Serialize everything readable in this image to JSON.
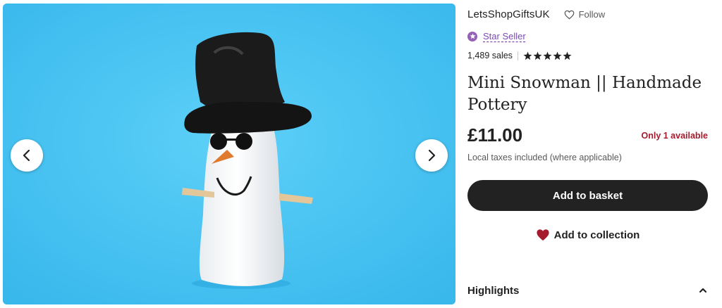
{
  "gallery": {
    "image_alt": "Mini snowman pottery figurine with black top hat and sunglasses on a blue background",
    "prev_icon": "chevron-left-icon",
    "next_icon": "chevron-right-icon",
    "background_color": "#4cc5f4"
  },
  "shop": {
    "name": "LetsShopGiftsUK",
    "follow_label": "Follow",
    "follow_icon": "heart-outline-icon",
    "badge_label": "Star Seller",
    "badge_icon": "star-seller-badge-icon",
    "sales": "1,489 sales",
    "rating_stars": 5
  },
  "listing": {
    "title": "Mini Snowman || Handmade Pottery",
    "price": "£11.00",
    "availability": "Only 1 available",
    "tax_note": "Local taxes included (where applicable)"
  },
  "actions": {
    "add_to_basket": "Add to basket",
    "add_to_collection": "Add to collection",
    "collection_icon": "heart-filled-icon"
  },
  "sections": {
    "highlights": "Highlights",
    "highlights_icon": "chevron-up-icon"
  },
  "colors": {
    "primary_button": "#222222",
    "availability": "#a61a2e",
    "star_seller": "#7b4bb0",
    "heart": "#a61a2e"
  }
}
